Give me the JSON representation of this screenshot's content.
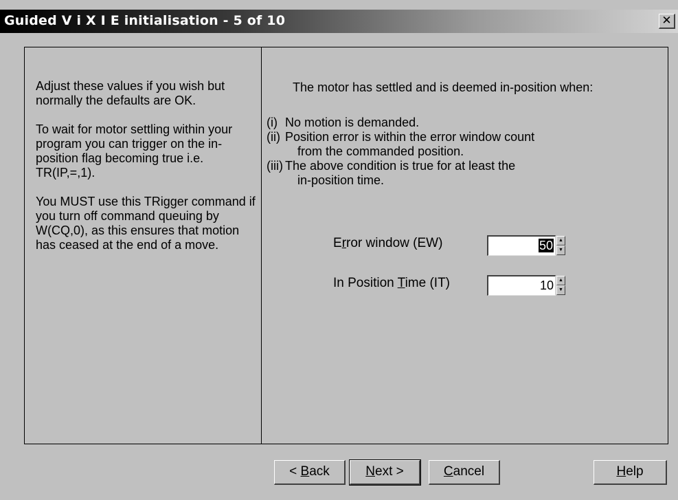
{
  "window": {
    "title": "Guided V i X I E initialisation - 5 of 10",
    "close_label": "✕"
  },
  "left_panel": {
    "paragraphs": [
      "Adjust these values if you wish but normally the defaults are OK.",
      "To wait for motor settling within your program you can trigger on the in-position flag becoming true i.e. TR(IP,=,1).",
      "You MUST use this TRigger command if you turn off command queuing by W(CQ,0), as this ensures that motion has ceased at the end of a move."
    ]
  },
  "right_panel": {
    "intro": "The motor has settled and is deemed in-position when:",
    "conditions": [
      {
        "num": "(i)",
        "line1": "No motion is demanded.",
        "line2": ""
      },
      {
        "num": "(ii)",
        "line1": "Position error is within the error window count",
        "line2": "from the commanded position."
      },
      {
        "num": "(iii)",
        "line1": "The above condition is true for at least the",
        "line2": "in-position time."
      }
    ],
    "fields": {
      "error_window": {
        "label_pre": "E",
        "label_accel": "r",
        "label_post": "ror window (EW)",
        "value": "50"
      },
      "in_position_time": {
        "label_pre": "In Position ",
        "label_accel": "T",
        "label_post": "ime (IT)",
        "value": "10"
      }
    }
  },
  "buttons": {
    "back": {
      "pre": "< ",
      "accel": "B",
      "post": "ack"
    },
    "next": {
      "pre": "",
      "accel": "N",
      "post": "ext >"
    },
    "cancel": {
      "pre": "",
      "accel": "C",
      "post": "ancel"
    },
    "help": {
      "pre": "",
      "accel": "H",
      "post": "elp"
    }
  }
}
